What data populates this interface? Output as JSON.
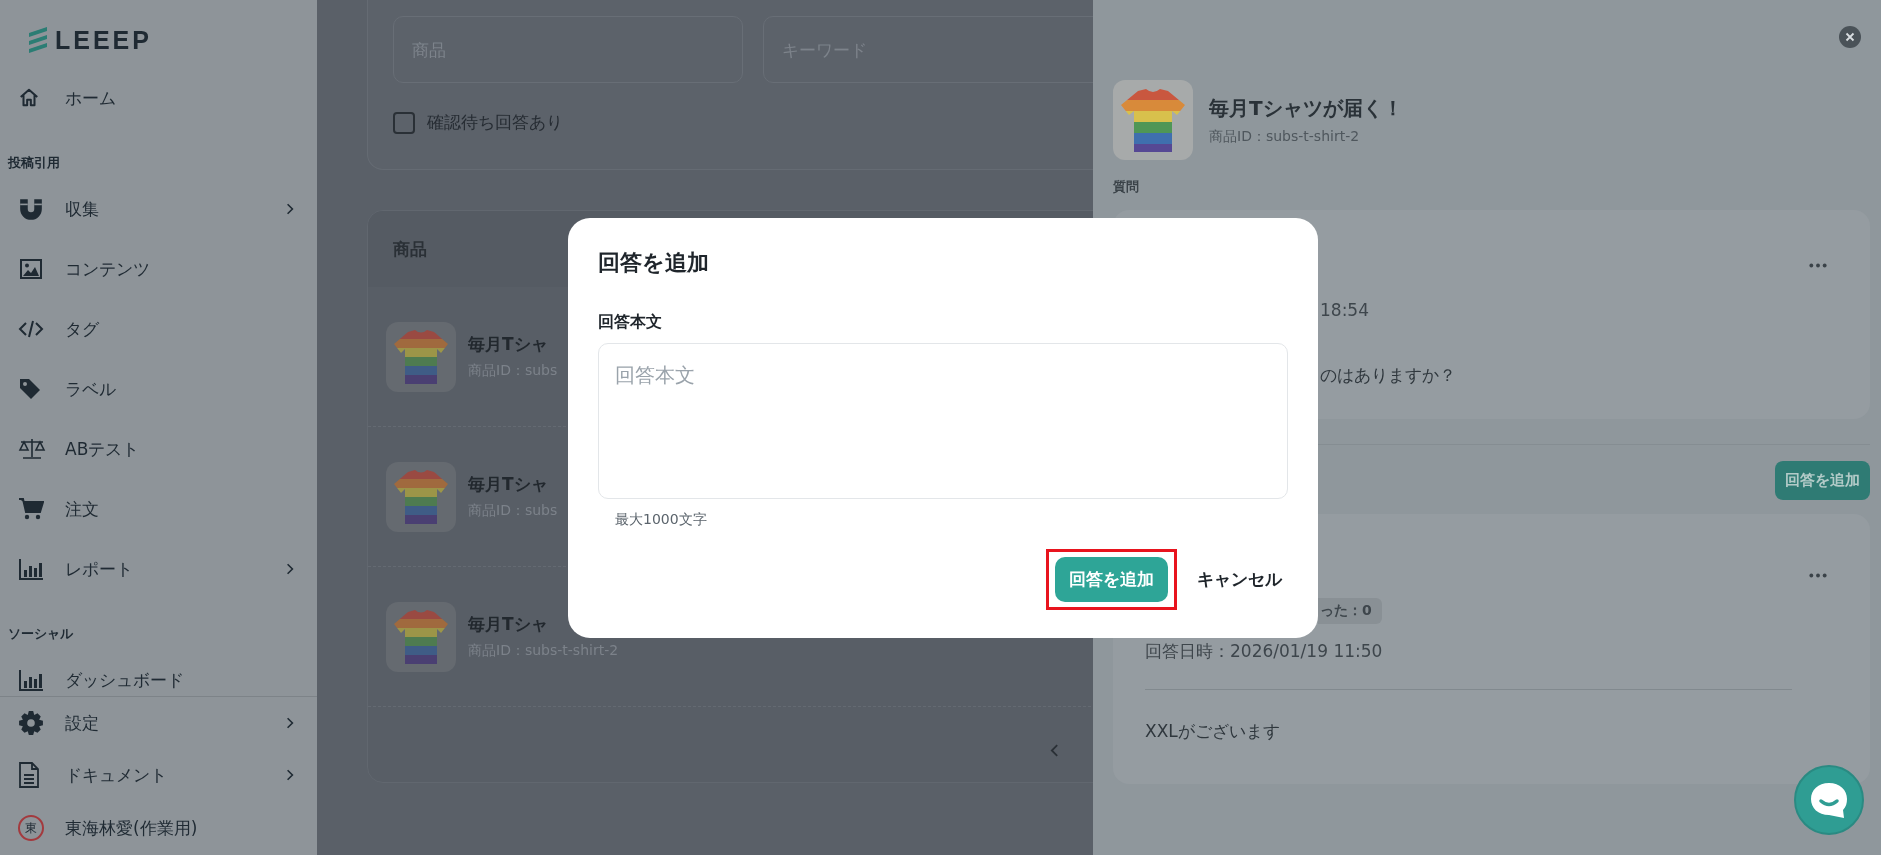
{
  "sidebar": {
    "logo": "LEEEP",
    "nav": [
      {
        "kind": "item",
        "label": "ホーム",
        "has_submenu": false
      },
      {
        "kind": "heading",
        "label": "投稿引用"
      },
      {
        "kind": "item",
        "label": "収集",
        "has_submenu": true
      },
      {
        "kind": "item",
        "label": "コンテンツ",
        "has_submenu": false
      },
      {
        "kind": "item",
        "label": "タグ",
        "has_submenu": false
      },
      {
        "kind": "item",
        "label": "ラベル",
        "has_submenu": false
      },
      {
        "kind": "item",
        "label": "ABテスト",
        "has_submenu": false
      },
      {
        "kind": "item",
        "label": "注文",
        "has_submenu": false
      },
      {
        "kind": "item",
        "label": "レポート",
        "has_submenu": true
      },
      {
        "kind": "heading",
        "label": "ソーシャル"
      },
      {
        "kind": "item",
        "label": "ダッシュボード",
        "has_submenu": false
      }
    ],
    "footer_items": [
      {
        "label": "設定",
        "has_submenu": true
      },
      {
        "label": "ドキュメント",
        "has_submenu": true
      }
    ],
    "user": {
      "avatar": "東",
      "name": "東海林愛(作業用)"
    }
  },
  "filters": {
    "product_field": {
      "placeholder": "商品"
    },
    "keyword_field": {
      "placeholder": "キーワード"
    },
    "pending_checkbox": {
      "label": "確認待ち回答あり",
      "checked": false
    }
  },
  "product_list": {
    "column": "商品",
    "rows": [
      {
        "name": "毎月Tシャ",
        "product_id": "商品ID：subs"
      },
      {
        "name": "毎月Tシャ",
        "product_id": "商品ID：subs"
      },
      {
        "name": "毎月Tシャ",
        "product_id": "商品ID：subs-t-shirt-2"
      }
    ]
  },
  "detail_panel": {
    "product": {
      "title": "毎月Tシャツが届く！",
      "product_id": "商品ID：subs-t-shirt-2"
    },
    "question_heading": "質問",
    "question": {
      "time": "18:54",
      "text": "のはありますか？"
    },
    "add_answer_button": "回答を追加",
    "answer": {
      "badge": "った：0",
      "answered_at": "回答日時：2026/01/19 11:50",
      "text": "XXLがございます"
    }
  },
  "modal": {
    "title": "回答を追加",
    "field_label": "回答本文",
    "placeholder": "回答本文",
    "hint": "最大1000文字",
    "submit": "回答を追加",
    "cancel": "キャンセル"
  }
}
